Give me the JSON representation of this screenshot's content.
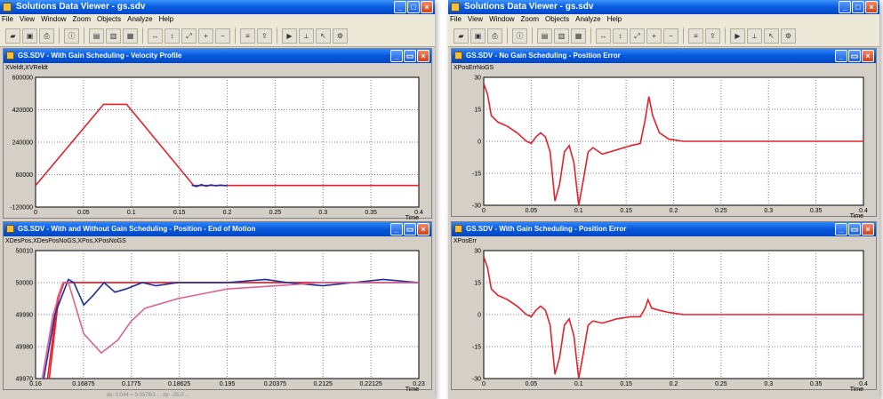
{
  "colors": {
    "title_start": "#3d95ff",
    "title_end": "#0046c8",
    "series_red": "#e8202a",
    "series_blue": "#1a2f9e",
    "series_pink": "#e06090",
    "grid": "#808080",
    "plot_bg": "#ffffff"
  },
  "windows": [
    {
      "title": "Solutions Data Viewer - gs.sdv",
      "menu": [
        "File",
        "View",
        "Window",
        "Zoom",
        "Objects",
        "Analyze",
        "Help"
      ],
      "toolbar": [
        "open-icon",
        "save-icon",
        "print-icon",
        "sep",
        "graph-info-icon",
        "sep",
        "chart1-icon",
        "chart2-icon",
        "chart3-icon",
        "sep",
        "zoom-x-icon",
        "zoom-y-icon",
        "zoom-xy-icon",
        "zoom-in-icon",
        "zoom-out-icon",
        "sep",
        "data-icon",
        "export-icon",
        "sep",
        "start-icon",
        "measure-icon",
        "cursor-icon",
        "settings-icon"
      ],
      "footer": "dx: 0.044 = 0.0376/1 ...   dy: -25.0  ...",
      "panels": [
        {
          "title": "GS.SDV - With Gain Scheduling - Velocity Profile",
          "signals": "XVeldt,XVReldt",
          "x_ticks": [
            "0",
            "0.05",
            "0.1",
            "0.15",
            "0.2",
            "0.25",
            "0.3",
            "0.35",
            "0.4"
          ],
          "y_ticks": [
            "600000",
            "420000",
            "240000",
            "60000",
            "-120000"
          ],
          "x_unit": "Time"
        },
        {
          "title": "GS.SDV - With and Without Gain Scheduling - Position - End of Motion",
          "signals": "XDesPos,XDesPosNoGS,XPos,XPosNoGS",
          "x_ticks": [
            "0.16",
            "0.16875",
            "0.1775",
            "0.18625",
            "0.195",
            "0.20375",
            "0.2125",
            "0.22125",
            "0.23"
          ],
          "y_ticks": [
            "50010",
            "50000",
            "49990",
            "49980",
            "49970"
          ],
          "x_unit": "Time"
        }
      ]
    },
    {
      "title": "Solutions Data Viewer - gs.sdv",
      "menu": [
        "File",
        "View",
        "Window",
        "Zoom",
        "Objects",
        "Analyze",
        "Help"
      ],
      "toolbar": [
        "open-icon",
        "save-icon",
        "print-icon",
        "sep",
        "graph-info-icon",
        "sep",
        "chart1-icon",
        "chart2-icon",
        "chart3-icon",
        "sep",
        "zoom-x-icon",
        "zoom-y-icon",
        "zoom-xy-icon",
        "zoom-in-icon",
        "zoom-out-icon",
        "sep",
        "data-icon",
        "export-icon",
        "sep",
        "start-icon",
        "measure-icon",
        "cursor-icon",
        "settings-icon"
      ],
      "footer": "",
      "panels": [
        {
          "title": "GS.SDV - No Gain Scheduling - Position Error",
          "signals": "XPosErrNoGS",
          "x_ticks": [
            "0",
            "0.05",
            "0.1",
            "0.15",
            "0.2",
            "0.25",
            "0.3",
            "0.35",
            "0.4"
          ],
          "y_ticks": [
            "30",
            "15",
            "0",
            "-15",
            "-30"
          ],
          "x_unit": "Time"
        },
        {
          "title": "GS.SDV - With Gain Scheduling - Position Error",
          "signals": "XPosErr",
          "x_ticks": [
            "0",
            "0.05",
            "0.1",
            "0.15",
            "0.2",
            "0.25",
            "0.3",
            "0.35",
            "0.4"
          ],
          "y_ticks": [
            "30",
            "15",
            "0",
            "-15",
            "-30"
          ],
          "x_unit": "Time"
        }
      ]
    }
  ],
  "chart_data": [
    {
      "type": "line",
      "xlim": [
        0,
        0.4
      ],
      "ylim": [
        -120000,
        600000
      ],
      "grid": true,
      "series": [
        {
          "name": "XVeldt",
          "color": "#e8202a",
          "points": [
            [
              0,
              0
            ],
            [
              0.071,
              450000
            ],
            [
              0.095,
              450000
            ],
            [
              0.165,
              0
            ],
            [
              0.4,
              0
            ]
          ]
        },
        {
          "name": "XVReldt",
          "color": "#1a2f9e",
          "points": [
            [
              0.163,
              2000
            ],
            [
              0.168,
              -6000
            ],
            [
              0.173,
              5000
            ],
            [
              0.178,
              -4000
            ],
            [
              0.183,
              3000
            ],
            [
              0.188,
              -2000
            ],
            [
              0.193,
              2000
            ],
            [
              0.198,
              -1000
            ],
            [
              0.2,
              0
            ]
          ]
        }
      ]
    },
    {
      "type": "line",
      "xlim": [
        0.16,
        0.23
      ],
      "ylim": [
        49970,
        50010
      ],
      "grid": true,
      "series": [
        {
          "name": "XDesPos",
          "color": "#e8202a",
          "points": [
            [
              0.1625,
              49970
            ],
            [
              0.1642,
              49995
            ],
            [
              0.1652,
              50000
            ],
            [
              0.23,
              50000
            ]
          ]
        },
        {
          "name": "XDesPosNoGS",
          "color": "#e8202a",
          "points": [
            [
              0.1622,
              49970
            ],
            [
              0.164,
              49995
            ],
            [
              0.165,
              50000
            ],
            [
              0.23,
              50000
            ]
          ]
        },
        {
          "name": "XPos",
          "color": "#1a2f9e",
          "points": [
            [
              0.1615,
              49970
            ],
            [
              0.1635,
              49990
            ],
            [
              0.166,
              50001
            ],
            [
              0.167,
              50000
            ],
            [
              0.1688,
              49993
            ],
            [
              0.1705,
              49996
            ],
            [
              0.1725,
              50000
            ],
            [
              0.1745,
              49997
            ],
            [
              0.1765,
              49998
            ],
            [
              0.1795,
              50000
            ],
            [
              0.182,
              49999
            ],
            [
              0.186,
              50000
            ],
            [
              0.195,
              50000
            ],
            [
              0.202,
              50001
            ],
            [
              0.206,
              50000
            ],
            [
              0.2125,
              49999
            ],
            [
              0.218,
              50000
            ],
            [
              0.2235,
              50001
            ],
            [
              0.23,
              50000
            ]
          ]
        },
        {
          "name": "XPosNoGS",
          "color": "#e06090",
          "points": [
            [
              0.1612,
              49970
            ],
            [
              0.1632,
              49990
            ],
            [
              0.165,
              50000
            ],
            [
              0.166,
              50000
            ],
            [
              0.1688,
              49984
            ],
            [
              0.172,
              49978
            ],
            [
              0.175,
              49982
            ],
            [
              0.1775,
              49988
            ],
            [
              0.18,
              49992
            ],
            [
              0.186,
              49995
            ],
            [
              0.195,
              49998
            ],
            [
              0.204,
              49999
            ],
            [
              0.2125,
              50000
            ],
            [
              0.23,
              50000
            ]
          ]
        }
      ]
    },
    {
      "type": "line",
      "xlim": [
        0,
        0.4
      ],
      "ylim": [
        -30,
        30
      ],
      "grid": true,
      "series": [
        {
          "name": "XPosErrNoGS",
          "color": "#e8202a",
          "points": [
            [
              0,
              27
            ],
            [
              0.004,
              22
            ],
            [
              0.008,
              12
            ],
            [
              0.015,
              9
            ],
            [
              0.025,
              7
            ],
            [
              0.035,
              4
            ],
            [
              0.045,
              0
            ],
            [
              0.05,
              -1
            ],
            [
              0.055,
              2
            ],
            [
              0.06,
              4
            ],
            [
              0.065,
              2
            ],
            [
              0.07,
              -5
            ],
            [
              0.075,
              -28
            ],
            [
              0.08,
              -20
            ],
            [
              0.085,
              -5
            ],
            [
              0.09,
              -2
            ],
            [
              0.095,
              -10
            ],
            [
              0.1,
              -30
            ],
            [
              0.105,
              -18
            ],
            [
              0.11,
              -5
            ],
            [
              0.115,
              -3
            ],
            [
              0.125,
              -6
            ],
            [
              0.14,
              -4
            ],
            [
              0.155,
              -2
            ],
            [
              0.165,
              -1
            ],
            [
              0.17,
              10
            ],
            [
              0.174,
              21
            ],
            [
              0.178,
              12
            ],
            [
              0.185,
              4
            ],
            [
              0.195,
              1
            ],
            [
              0.21,
              0
            ],
            [
              0.4,
              0
            ]
          ]
        }
      ]
    },
    {
      "type": "line",
      "xlim": [
        0,
        0.4
      ],
      "ylim": [
        -30,
        30
      ],
      "grid": true,
      "series": [
        {
          "name": "XPosErr",
          "color": "#e8202a",
          "points": [
            [
              0,
              27
            ],
            [
              0.004,
              22
            ],
            [
              0.008,
              12
            ],
            [
              0.015,
              9
            ],
            [
              0.025,
              7
            ],
            [
              0.035,
              4
            ],
            [
              0.045,
              0
            ],
            [
              0.05,
              -1
            ],
            [
              0.055,
              2
            ],
            [
              0.06,
              4
            ],
            [
              0.065,
              2
            ],
            [
              0.07,
              -5
            ],
            [
              0.075,
              -28
            ],
            [
              0.08,
              -20
            ],
            [
              0.085,
              -5
            ],
            [
              0.09,
              -2
            ],
            [
              0.095,
              -10
            ],
            [
              0.1,
              -30
            ],
            [
              0.105,
              -18
            ],
            [
              0.11,
              -5
            ],
            [
              0.115,
              -3
            ],
            [
              0.125,
              -4
            ],
            [
              0.14,
              -2
            ],
            [
              0.155,
              -1
            ],
            [
              0.165,
              -1
            ],
            [
              0.17,
              3
            ],
            [
              0.173,
              7
            ],
            [
              0.177,
              3
            ],
            [
              0.185,
              2
            ],
            [
              0.195,
              1
            ],
            [
              0.21,
              0
            ],
            [
              0.4,
              0
            ]
          ]
        }
      ]
    }
  ]
}
